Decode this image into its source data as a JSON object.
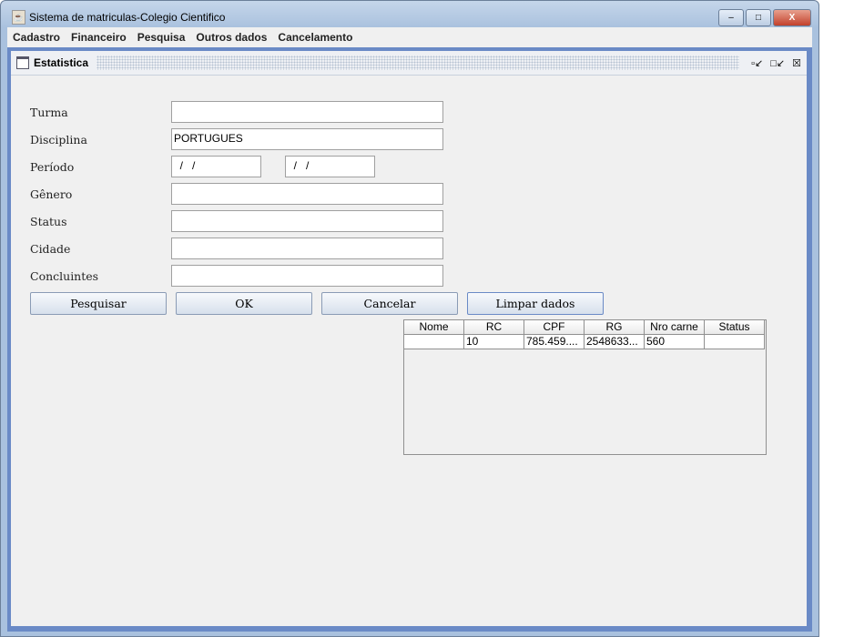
{
  "window": {
    "title": "Sistema de matriculas-Colegio Cientifico",
    "minimize": "–",
    "maximize": "□",
    "close": "X"
  },
  "menu": [
    "Cadastro",
    "Financeiro",
    "Pesquisa",
    "Outros dados",
    "Cancelamento"
  ],
  "internal_frame": {
    "title": "Estatistica",
    "iconify": "▫↙",
    "maximize": "□↙",
    "close": "☒"
  },
  "form": {
    "labels": {
      "turma": "Turma",
      "disciplina": "Disciplina",
      "periodo": "Período",
      "genero": "Gênero",
      "status": "Status",
      "cidade": "Cidade",
      "concluintes": "Concluintes"
    },
    "values": {
      "turma": "",
      "disciplina": "PORTUGUES",
      "periodo_inicio": "  /   /",
      "periodo_fim": "  /   /",
      "genero": "",
      "status": "",
      "cidade": "",
      "concluintes": ""
    }
  },
  "buttons": {
    "pesquisar": "Pesquisar",
    "ok": "OK",
    "cancelar": "Cancelar",
    "limpar": "Limpar dados"
  },
  "table": {
    "columns": [
      "Nome",
      "RC",
      "CPF",
      "RG",
      "Nro carne",
      "Status"
    ],
    "rows": [
      [
        "",
        "10",
        "785.459....",
        "2548633...",
        "560",
        ""
      ]
    ]
  }
}
